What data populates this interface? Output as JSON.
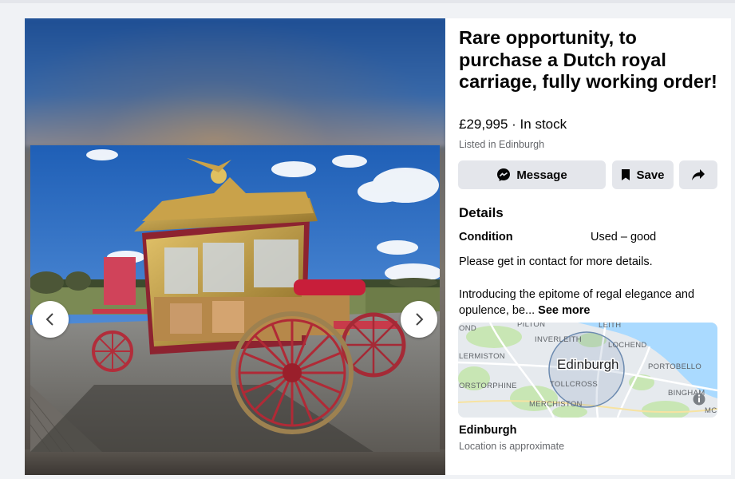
{
  "listing": {
    "title": "Rare opportunity, to purchase a Dutch royal carriage, fully working order!",
    "price_line": "£29,995 · In stock",
    "listed_in": "Listed in Edinburgh"
  },
  "actions": {
    "message_label": "Message",
    "save_label": "Save",
    "message_icon": "messenger-icon",
    "save_icon": "bookmark-icon",
    "share_icon": "share-arrow-icon"
  },
  "details": {
    "heading": "Details",
    "condition_label": "Condition",
    "condition_value": "Used – good",
    "contact_note": "Please get in contact for more details.",
    "description_preview": "Introducing the epitome of regal elegance and opulence, be...",
    "see_more_label": "See more"
  },
  "map": {
    "labels": {
      "pilton": "PILTON",
      "leith": "LEITH",
      "inverleith": "INVERLEITH",
      "lochend": "LOCHEND",
      "ond": "OND",
      "lermiston": "LERMISTON",
      "edinburgh": "Edinburgh",
      "portobello": "PORTOBELLO",
      "tollcross": "TOLLCROSS",
      "corstorphine": "ORSTORPHINE",
      "bingham": "BINGHAM",
      "merchiston": "MERCHISTON",
      "mc": "MC"
    },
    "info_icon": "info-icon"
  },
  "location": {
    "name": "Edinburgh",
    "note": "Location is approximate"
  },
  "gallery": {
    "prev_icon": "chevron-left-icon",
    "next_icon": "chevron-right-icon"
  },
  "colors": {
    "button_bg": "#e4e6eb",
    "secondary_text": "#65676b",
    "map_water": "#aadaff",
    "map_park": "#c8e6b4"
  }
}
